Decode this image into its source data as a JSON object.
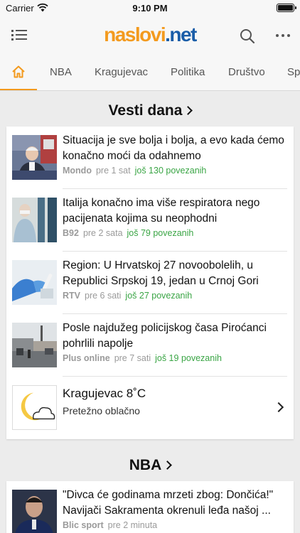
{
  "status_bar": {
    "carrier": "Carrier",
    "time": "9:10 PM"
  },
  "header": {
    "logo_part1": "naslovi",
    "logo_part2": ".net"
  },
  "tabs": [
    {
      "label": "NBA"
    },
    {
      "label": "Kragujevac"
    },
    {
      "label": "Politika"
    },
    {
      "label": "Društvo"
    },
    {
      "label": "Sport"
    }
  ],
  "sections": [
    {
      "title": "Vesti dana",
      "items": [
        {
          "headline": "Situacija je sve bolja i bolja, a evo kada ćemo konačno moći da odahnemo",
          "source": "Mondo",
          "time": "pre 1 sat",
          "related": "još 130 povezanih"
        },
        {
          "headline": "Italija konačno ima više respiratora nego pacijenata kojima su neophodni",
          "source": "B92",
          "time": "pre 2 sata",
          "related": "još 79 povezanih"
        },
        {
          "headline": "Region: U Hrvatskoj 27 novoobolelih, u Republici Srpskoj 19, jedan u Crnoj Gori",
          "source": "RTV",
          "time": "pre 6 sati",
          "related": "još 27 povezanih"
        },
        {
          "headline": "Posle najdužeg policijskog časa Piroćanci pohrlili napolje",
          "source": "Plus online",
          "time": "pre 7 sati",
          "related": "još 19 povezanih"
        }
      ]
    },
    {
      "title": "NBA",
      "items": [
        {
          "headline": "\"Divca će godinama mrzeti zbog: Dončića!\" Navijači Sakramenta okrenuli leđa našoj ...",
          "source": "Blic sport",
          "time": "pre 2 minuta",
          "related": ""
        }
      ]
    }
  ],
  "weather": {
    "city": "Kragujevac 8˚C",
    "description": "Pretežno oblačno"
  },
  "colors": {
    "accent": "#f39a1e",
    "brand_blue": "#1a5da8",
    "related_green": "#3aa545"
  }
}
